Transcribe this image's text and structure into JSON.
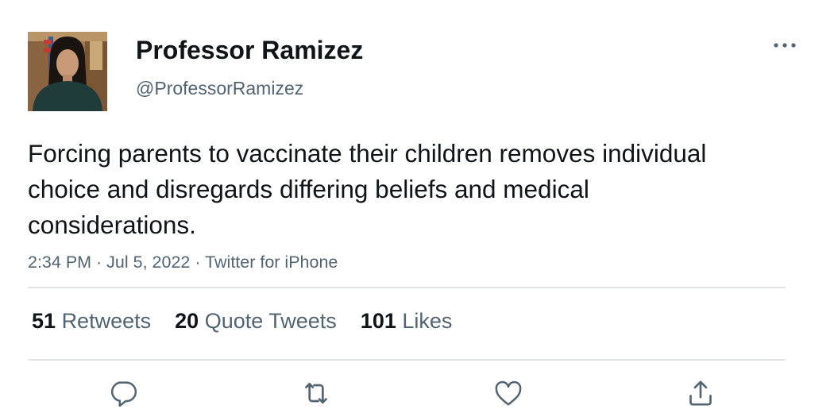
{
  "author": {
    "display_name": "Professor Ramizez",
    "handle": "@ProfessorRamizez"
  },
  "tweet": {
    "text": "Forcing parents to vaccinate their children removes individual choice and disregards differing beliefs and medical considerations.",
    "meta": "2:34 PM · Jul 5, 2022 · Twitter for iPhone"
  },
  "stats": {
    "retweets_count": "51",
    "retweets_label": "Retweets",
    "quotes_count": "20",
    "quotes_label": "Quote Tweets",
    "likes_count": "101",
    "likes_label": "Likes"
  },
  "icons": {
    "more": "more-horizontal-icon",
    "reply": "reply-icon",
    "retweet": "retweet-icon",
    "like": "heart-icon",
    "share": "share-icon"
  },
  "colors": {
    "text_primary": "#0f1419",
    "text_secondary": "#536471",
    "divider": "#e1e4e7"
  }
}
